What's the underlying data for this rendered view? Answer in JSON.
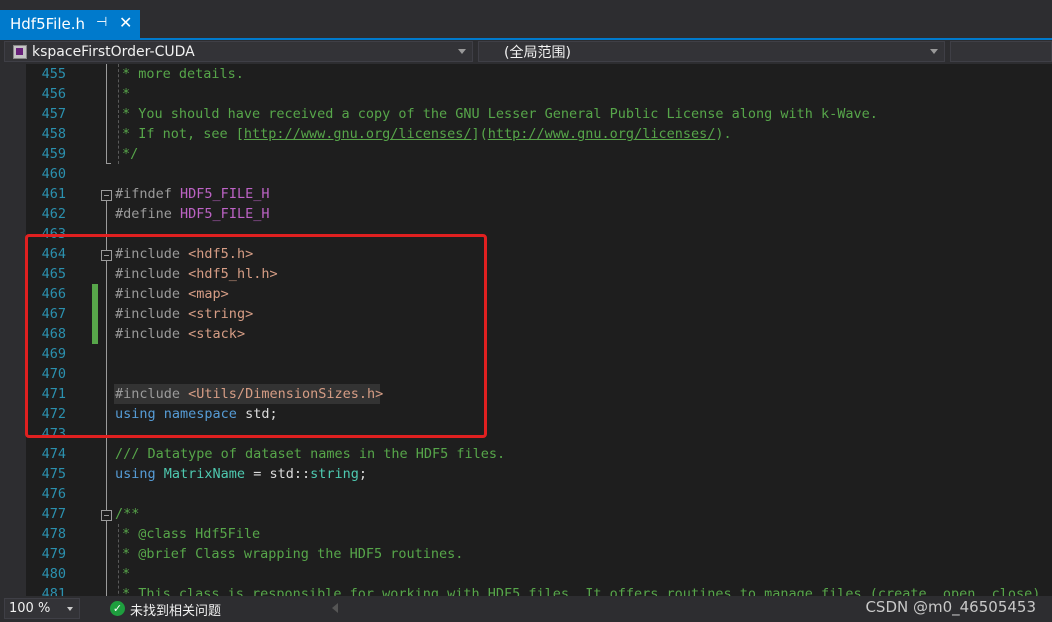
{
  "tab": {
    "title": "Hdf5File.h",
    "pin_glyph": "⊣",
    "close_glyph": "✕"
  },
  "navbar": {
    "project": "kspaceFirstOrder-CUDA",
    "scope": "(全局范围)"
  },
  "lines": [
    {
      "n": "455",
      "html": "* more details."
    },
    {
      "n": "456",
      "html": "*"
    },
    {
      "n": "457",
      "html": "* You should have received a copy of the GNU Lesser General Public License along with k-Wave."
    },
    {
      "n": "458",
      "html": "* If not, see [http://www.gnu.org/licenses/](http://www.gnu.org/licenses/)."
    },
    {
      "n": "459",
      "html": "*/"
    },
    {
      "n": "460",
      "html": ""
    },
    {
      "n": "461",
      "html": "#ifndef HDF5_FILE_H"
    },
    {
      "n": "462",
      "html": "#define HDF5_FILE_H"
    },
    {
      "n": "463",
      "html": ""
    },
    {
      "n": "464",
      "html": "#include <hdf5.h>"
    },
    {
      "n": "465",
      "html": "#include <hdf5_hl.h>"
    },
    {
      "n": "466",
      "html": "#include <map>"
    },
    {
      "n": "467",
      "html": "#include <string>"
    },
    {
      "n": "468",
      "html": "#include <stack>"
    },
    {
      "n": "469",
      "html": ""
    },
    {
      "n": "470",
      "html": ""
    },
    {
      "n": "471",
      "html": "#include <Utils/DimensionSizes.h>"
    },
    {
      "n": "472",
      "html": "using namespace std;"
    },
    {
      "n": "473",
      "html": ""
    },
    {
      "n": "474",
      "html": "/// Datatype of dataset names in the HDF5 files."
    },
    {
      "n": "475",
      "html": "using MatrixName = std::string;"
    },
    {
      "n": "476",
      "html": ""
    },
    {
      "n": "477",
      "html": "/**"
    },
    {
      "n": "478",
      "html": "* @class Hdf5File"
    },
    {
      "n": "479",
      "html": "* @brief Class wrapping the HDF5 routines."
    },
    {
      "n": "480",
      "html": "*"
    },
    {
      "n": "481",
      "html": "* This class is responsible for working with HDF5 files. It offers routines to manage files (create, open, close)"
    }
  ],
  "status": {
    "zoom": "100 %",
    "issues": "未找到相关问题",
    "ok_glyph": "✓"
  },
  "watermark": "CSDN @m0_46505453"
}
